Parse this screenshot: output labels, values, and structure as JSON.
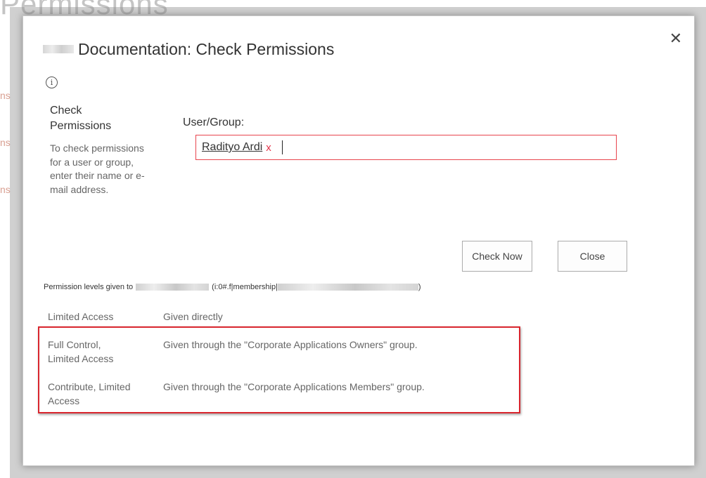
{
  "background": {
    "title": "Permissions",
    "links": [
      "ns",
      "ns",
      "ns"
    ]
  },
  "dialog": {
    "title": "Documentation: Check Permissions",
    "close_glyph": "✕",
    "info_glyph": "i",
    "section_heading": "Check Permissions",
    "section_description": "To check permissions for a user or group, enter their name or e-mail address.",
    "user_group_label": "User/Group:",
    "user_group_value": "Radityo Ardi",
    "remove_glyph": "x",
    "buttons": {
      "check_now": "Check Now",
      "close": "Close"
    },
    "permission_levels_prefix": "Permission levels given to",
    "permission_levels_mid": "(i:0#.f|membership|",
    "permission_levels_suffix": ")",
    "permissions": [
      {
        "level": "Limited Access",
        "source": "Given directly"
      },
      {
        "level": "Full Control, Limited Access",
        "source": "Given through the \"Corporate Applications Owners\" group."
      },
      {
        "level": "Contribute, Limited Access",
        "source": "Given through the \"Corporate Applications Members\" group."
      }
    ]
  },
  "colors": {
    "accent_error": "#e8444d",
    "highlight": "#d9262e"
  }
}
